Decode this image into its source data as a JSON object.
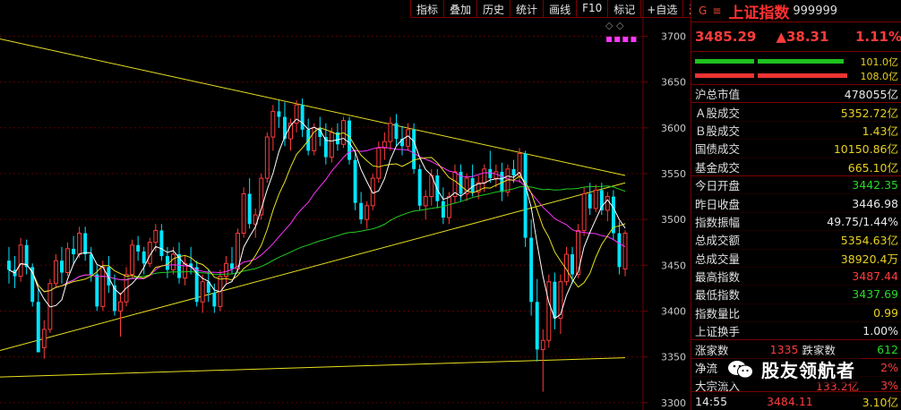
{
  "toolbar": {
    "buttons": [
      "指标",
      "叠加",
      "历史",
      "统计",
      "画线",
      "F10",
      "标记",
      "+自选",
      "返回"
    ]
  },
  "chart_icons": {
    "diamonds": "◇ ◇",
    "dots": "▪▪▪▪"
  },
  "chart_data": {
    "type": "candlestick",
    "y_ticks": [
      3700,
      3650,
      3600,
      3550,
      3500,
      3450,
      3400,
      3350,
      3300
    ],
    "ylim": [
      3292,
      3720
    ],
    "colors": {
      "up": "#ff3b3b",
      "down": "#00e5ff",
      "ma5": "#ffffff",
      "ma10": "#e8e020",
      "ma20": "#ff33ff",
      "ma60": "#22cc22",
      "trendline": "#e8e020"
    },
    "candles": [
      [
        3455,
        3470,
        3430,
        3445
      ],
      [
        3445,
        3460,
        3425,
        3438
      ],
      [
        3438,
        3480,
        3432,
        3472
      ],
      [
        3472,
        3478,
        3440,
        3448
      ],
      [
        3448,
        3452,
        3405,
        3410
      ],
      [
        3410,
        3425,
        3370,
        3355
      ],
      [
        3360,
        3390,
        3348,
        3380
      ],
      [
        3380,
        3435,
        3376,
        3430
      ],
      [
        3430,
        3462,
        3426,
        3455
      ],
      [
        3455,
        3470,
        3430,
        3442
      ],
      [
        3442,
        3475,
        3438,
        3468
      ],
      [
        3468,
        3482,
        3450,
        3462
      ],
      [
        3462,
        3492,
        3458,
        3485
      ],
      [
        3485,
        3492,
        3455,
        3462
      ],
      [
        3462,
        3470,
        3432,
        3440
      ],
      [
        3440,
        3450,
        3400,
        3405
      ],
      [
        3405,
        3455,
        3400,
        3448
      ],
      [
        3448,
        3460,
        3420,
        3428
      ],
      [
        3428,
        3440,
        3395,
        3400
      ],
      [
        3400,
        3420,
        3372,
        3410
      ],
      [
        3410,
        3448,
        3405,
        3440
      ],
      [
        3440,
        3478,
        3436,
        3472
      ],
      [
        3472,
        3482,
        3455,
        3465
      ],
      [
        3465,
        3470,
        3440,
        3452
      ],
      [
        3452,
        3480,
        3448,
        3475
      ],
      [
        3475,
        3495,
        3465,
        3488
      ],
      [
        3488,
        3495,
        3455,
        3460
      ],
      [
        3460,
        3470,
        3436,
        3445
      ],
      [
        3445,
        3470,
        3440,
        3462
      ],
      [
        3462,
        3475,
        3430,
        3436
      ],
      [
        3436,
        3460,
        3428,
        3452
      ],
      [
        3452,
        3470,
        3440,
        3448
      ],
      [
        3448,
        3455,
        3405,
        3410
      ],
      [
        3410,
        3440,
        3398,
        3432
      ],
      [
        3432,
        3445,
        3410,
        3420
      ],
      [
        3420,
        3430,
        3398,
        3405
      ],
      [
        3405,
        3445,
        3400,
        3438
      ],
      [
        3438,
        3460,
        3430,
        3452
      ],
      [
        3452,
        3470,
        3440,
        3446
      ],
      [
        3446,
        3490,
        3442,
        3485
      ],
      [
        3485,
        3535,
        3480,
        3528
      ],
      [
        3528,
        3545,
        3490,
        3495
      ],
      [
        3495,
        3512,
        3480,
        3505
      ],
      [
        3505,
        3550,
        3500,
        3545
      ],
      [
        3545,
        3595,
        3540,
        3590
      ],
      [
        3590,
        3625,
        3575,
        3618
      ],
      [
        3618,
        3630,
        3600,
        3612
      ],
      [
        3612,
        3628,
        3580,
        3588
      ],
      [
        3588,
        3610,
        3575,
        3605
      ],
      [
        3605,
        3630,
        3595,
        3625
      ],
      [
        3625,
        3632,
        3590,
        3598
      ],
      [
        3598,
        3610,
        3570,
        3575
      ],
      [
        3575,
        3605,
        3570,
        3600
      ],
      [
        3600,
        3612,
        3580,
        3590
      ],
      [
        3590,
        3605,
        3560,
        3568
      ],
      [
        3568,
        3600,
        3562,
        3595
      ],
      [
        3595,
        3605,
        3575,
        3582
      ],
      [
        3582,
        3612,
        3578,
        3608
      ],
      [
        3608,
        3612,
        3560,
        3565
      ],
      [
        3565,
        3575,
        3510,
        3518
      ],
      [
        3518,
        3530,
        3495,
        3500
      ],
      [
        3500,
        3520,
        3490,
        3515
      ],
      [
        3515,
        3550,
        3510,
        3545
      ],
      [
        3545,
        3585,
        3540,
        3578
      ],
      [
        3578,
        3595,
        3565,
        3585
      ],
      [
        3585,
        3612,
        3575,
        3605
      ],
      [
        3605,
        3615,
        3580,
        3588
      ],
      [
        3588,
        3602,
        3570,
        3580
      ],
      [
        3580,
        3605,
        3575,
        3598
      ],
      [
        3598,
        3605,
        3550,
        3555
      ],
      [
        3555,
        3560,
        3510,
        3515
      ],
      [
        3515,
        3532,
        3500,
        3525
      ],
      [
        3525,
        3555,
        3515,
        3548
      ],
      [
        3548,
        3555,
        3512,
        3520
      ],
      [
        3520,
        3535,
        3495,
        3502
      ],
      [
        3502,
        3530,
        3495,
        3525
      ],
      [
        3525,
        3560,
        3518,
        3552
      ],
      [
        3552,
        3560,
        3520,
        3528
      ],
      [
        3528,
        3550,
        3520,
        3545
      ],
      [
        3545,
        3560,
        3525,
        3530
      ],
      [
        3530,
        3548,
        3522,
        3540
      ],
      [
        3540,
        3560,
        3530,
        3555
      ],
      [
        3555,
        3575,
        3540,
        3545
      ],
      [
        3545,
        3560,
        3535,
        3552
      ],
      [
        3552,
        3562,
        3520,
        3530
      ],
      [
        3530,
        3560,
        3525,
        3555
      ],
      [
        3555,
        3565,
        3540,
        3548
      ],
      [
        3548,
        3578,
        3540,
        3572
      ],
      [
        3572,
        3575,
        3470,
        3480
      ],
      [
        3480,
        3500,
        3395,
        3410
      ],
      [
        3410,
        3435,
        3345,
        3358
      ],
      [
        3358,
        3380,
        3312,
        3368
      ],
      [
        3368,
        3440,
        3360,
        3432
      ],
      [
        3432,
        3442,
        3380,
        3392
      ],
      [
        3392,
        3440,
        3375,
        3432
      ],
      [
        3432,
        3470,
        3428,
        3462
      ],
      [
        3462,
        3470,
        3430,
        3440
      ],
      [
        3440,
        3495,
        3436,
        3488
      ],
      [
        3488,
        3535,
        3482,
        3528
      ],
      [
        3528,
        3540,
        3505,
        3512
      ],
      [
        3512,
        3538,
        3508,
        3532
      ],
      [
        3532,
        3540,
        3505,
        3510
      ],
      [
        3510,
        3530,
        3498,
        3525
      ],
      [
        3525,
        3532,
        3478,
        3485
      ],
      [
        3485,
        3498,
        3440,
        3448
      ],
      [
        3446,
        3488,
        3438,
        3485
      ]
    ]
  },
  "header": {
    "g_label": "G",
    "menu_icon": "≡",
    "index_name": "上证指数",
    "index_code": "999999"
  },
  "quote": {
    "price": "3485.29",
    "change": "▲38.31",
    "change_pct": "1.11%"
  },
  "bar_labels": {
    "green": "101.0亿",
    "red": "108.0亿"
  },
  "stats": [
    {
      "label": "沪总市值",
      "value": "478055亿",
      "color": "white"
    },
    {
      "label": "Ａ股成交",
      "value": "5352.72亿",
      "color": "yellow"
    },
    {
      "label": "Ｂ股成交",
      "value": "1.43亿",
      "color": "yellow"
    },
    {
      "label": "国债成交",
      "value": "10150.86亿",
      "color": "yellow"
    },
    {
      "label": "基金成交",
      "value": "665.10亿",
      "color": "yellow"
    },
    {
      "label": "今日开盘",
      "value": "3442.35",
      "color": "green"
    },
    {
      "label": "昨日收盘",
      "value": "3446.98",
      "color": "white"
    },
    {
      "label": "指数振幅",
      "value": "49.75/1.44%",
      "color": "white"
    },
    {
      "label": "总成交额",
      "value": "5354.63亿",
      "color": "yellow"
    },
    {
      "label": "总成交量",
      "value": "38920.4万",
      "color": "yellow"
    },
    {
      "label": "最高指数",
      "value": "3487.44",
      "color": "red"
    },
    {
      "label": "最低指数",
      "value": "3437.69",
      "color": "green"
    },
    {
      "label": "指数量比",
      "value": "0.99",
      "color": "yellow"
    },
    {
      "label": "上证换手",
      "value": "1.00%",
      "color": "white"
    }
  ],
  "breadth": {
    "up_label": "涨家数",
    "up_value": "1335",
    "down_label": "跌家数",
    "down_value": "612"
  },
  "flows": [
    {
      "label": "净流",
      "value": "2%"
    },
    {
      "label": "大宗流入",
      "amount": "133.2亿",
      "value": "3%"
    }
  ],
  "footer": {
    "time": "14:55",
    "price": "3484.11",
    "pct": "3.10亿"
  },
  "watermark": {
    "text": "股友领航者"
  }
}
